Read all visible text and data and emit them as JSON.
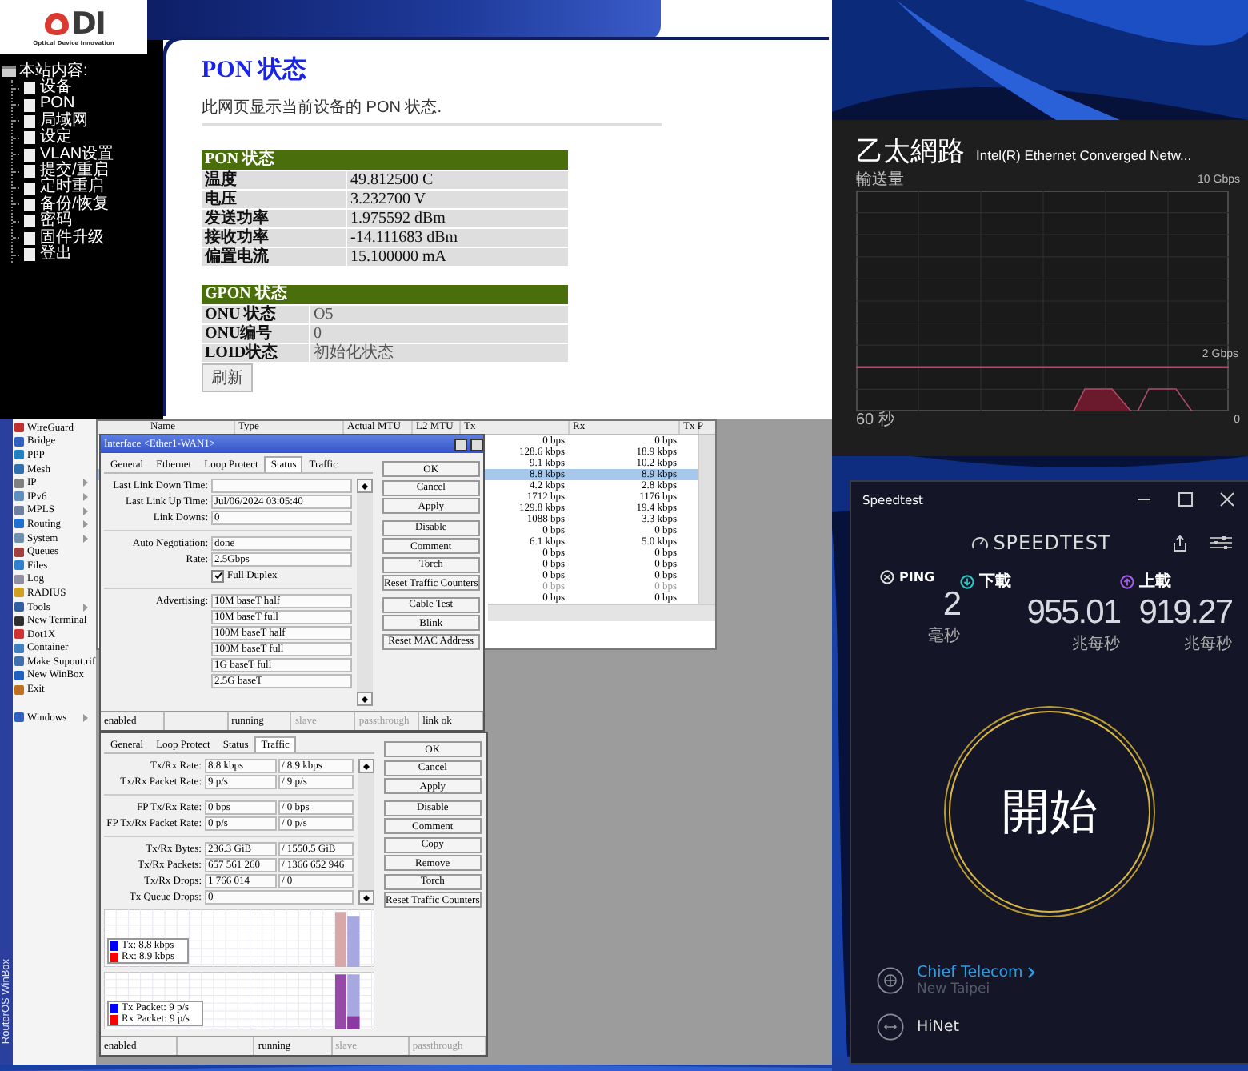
{
  "web_page": {
    "logo": {
      "text": "DI",
      "tagline": "Optical Device Innovation"
    },
    "sidebar": {
      "title": "本站内容:",
      "items": [
        "设备",
        "PON",
        "局域网",
        "设定",
        "VLAN设置",
        "提交/重启",
        "定时重启",
        "备份/恢复",
        "密码",
        "固件升级",
        "登出"
      ]
    },
    "title": "PON 状态",
    "description": "此网页显示当前设备的 PON 状态.",
    "tables": [
      {
        "heading": "PON 状态",
        "rows": [
          [
            "温度",
            "49.812500 C"
          ],
          [
            "电压",
            "3.232700 V"
          ],
          [
            "发送功率",
            "1.975592 dBm"
          ],
          [
            "接收功率",
            "-14.111683 dBm"
          ],
          [
            "偏置电流",
            "15.100000 mA"
          ]
        ]
      },
      {
        "heading": "GPON 状态",
        "rows": [
          [
            "ONU 状态",
            "O5"
          ],
          [
            "ONU编号",
            "0"
          ],
          [
            "LOID状态",
            "初始化状态"
          ]
        ]
      }
    ],
    "refresh_button": "刷新"
  },
  "task_manager": {
    "title": "乙太網路",
    "adapter": "Intel(R) Ethernet Converged Netw...",
    "chart_label": "輸送量",
    "max_label": "10 Gbps",
    "scale_label": "2 Gbps",
    "time_label": "60 秒",
    "zero_label": "0"
  },
  "speedtest": {
    "window_title": "Speedtest",
    "brand": "SPEEDTEST",
    "metrics": [
      {
        "kind": "ping",
        "label": "PING",
        "value": "2",
        "unit": "毫秒"
      },
      {
        "kind": "download",
        "label": "下載",
        "value": "955.01",
        "unit": "兆每秒"
      },
      {
        "kind": "upload",
        "label": "上載",
        "value": "919.27",
        "unit": "兆每秒"
      }
    ],
    "start_button": "開始",
    "server": {
      "name": "Chief Telecom",
      "location": "New Taipei"
    },
    "provider": "HiNet"
  },
  "winbox": {
    "vertical_label": "RouterOS WinBox",
    "menu": [
      {
        "label": "WireGuard",
        "submenu": false
      },
      {
        "label": "Bridge",
        "submenu": false
      },
      {
        "label": "PPP",
        "submenu": false
      },
      {
        "label": "Mesh",
        "submenu": false
      },
      {
        "label": "IP",
        "submenu": true
      },
      {
        "label": "IPv6",
        "submenu": true
      },
      {
        "label": "MPLS",
        "submenu": true
      },
      {
        "label": "Routing",
        "submenu": true
      },
      {
        "label": "System",
        "submenu": true
      },
      {
        "label": "Queues",
        "submenu": false
      },
      {
        "label": "Files",
        "submenu": false
      },
      {
        "label": "Log",
        "submenu": false
      },
      {
        "label": "RADIUS",
        "submenu": false
      },
      {
        "label": "Tools",
        "submenu": true
      },
      {
        "label": "New Terminal",
        "submenu": false
      },
      {
        "label": "Dot1X",
        "submenu": false
      },
      {
        "label": "Container",
        "submenu": false
      },
      {
        "label": "Make Supout.rif",
        "submenu": false
      },
      {
        "label": "New WinBox",
        "submenu": false
      },
      {
        "label": "Exit",
        "submenu": false
      }
    ],
    "windows_item": {
      "label": "Windows",
      "submenu": true
    },
    "interface_list": {
      "columns": [
        "Name",
        "Type",
        "Actual MTU",
        "L2 MTU",
        "Tx",
        "Rx",
        "Tx P"
      ],
      "rows": [
        {
          "tx": "0 bps",
          "rx": "0 bps",
          "selected": false,
          "disabled": false
        },
        {
          "tx": "128.6 kbps",
          "rx": "18.9 kbps",
          "selected": false,
          "disabled": false
        },
        {
          "tx": "9.1 kbps",
          "rx": "10.2 kbps",
          "selected": false,
          "disabled": false
        },
        {
          "tx": "8.8 kbps",
          "rx": "8.9 kbps",
          "selected": true,
          "disabled": false
        },
        {
          "tx": "4.2 kbps",
          "rx": "2.8 kbps",
          "selected": false,
          "disabled": false
        },
        {
          "tx": "1712 bps",
          "rx": "1176 bps",
          "selected": false,
          "disabled": false
        },
        {
          "tx": "129.8 kbps",
          "rx": "19.4 kbps",
          "selected": false,
          "disabled": false
        },
        {
          "tx": "1088 bps",
          "rx": "3.3 kbps",
          "selected": false,
          "disabled": false
        },
        {
          "tx": "0 bps",
          "rx": "0 bps",
          "selected": false,
          "disabled": false
        },
        {
          "tx": "6.1 kbps",
          "rx": "5.0 kbps",
          "selected": false,
          "disabled": false
        },
        {
          "tx": "0 bps",
          "rx": "0 bps",
          "selected": false,
          "disabled": false
        },
        {
          "tx": "0 bps",
          "rx": "0 bps",
          "selected": false,
          "disabled": false
        },
        {
          "tx": "0 bps",
          "rx": "0 bps",
          "selected": false,
          "disabled": false
        },
        {
          "tx": "0 bps",
          "rx": "0 bps",
          "selected": false,
          "disabled": true
        },
        {
          "tx": "0 bps",
          "rx": "0 bps",
          "selected": false,
          "disabled": false
        }
      ]
    },
    "interface_window": {
      "title": "Interface <Ether1-WAN1>",
      "tabs": [
        {
          "label": "General",
          "selected": false
        },
        {
          "label": "Ethernet",
          "selected": false
        },
        {
          "label": "Loop Protect",
          "selected": false
        },
        {
          "label": "Status",
          "selected": true
        },
        {
          "label": "Traffic",
          "selected": false
        }
      ],
      "fields": [
        {
          "kind": "field",
          "label": "Last Link Down Time:"
        },
        {
          "kind": "field",
          "label": "Last Link Up Time:",
          "value": "Jul/06/2024 03:05:40"
        },
        {
          "kind": "field",
          "label": "Link Downs:",
          "value": "0"
        },
        {
          "kind": "separator"
        },
        {
          "kind": "field",
          "label": "Auto Negotiation:",
          "value": "done"
        },
        {
          "kind": "field",
          "label": "Rate:",
          "value": "2.5Gbps"
        },
        {
          "kind": "checkbox",
          "label": "Full Duplex",
          "checked": true
        },
        {
          "kind": "separator"
        },
        {
          "kind": "list",
          "label": "Advertising:",
          "values": [
            "10M baseT half",
            "10M baseT full",
            "100M baseT half",
            "100M baseT full",
            "1G baseT full",
            "2.5G baseT"
          ]
        }
      ],
      "buttons": [
        "OK",
        "Cancel",
        "Apply",
        "Disable",
        "Comment",
        "Torch",
        "Reset Traffic Counters",
        "Cable Test",
        "Blink",
        "Reset MAC Address"
      ],
      "status": [
        {
          "text": "enabled",
          "disabled": false
        },
        {
          "text": "running",
          "disabled": false
        },
        {
          "text": "slave",
          "disabled": true
        },
        {
          "text": "passthrough",
          "disabled": true
        },
        {
          "text": "link ok",
          "disabled": false
        }
      ]
    },
    "traffic_window": {
      "tabs": [
        {
          "label": "General",
          "selected": false
        },
        {
          "label": "Loop Protect",
          "selected": false
        },
        {
          "label": "Status",
          "selected": false
        },
        {
          "label": "Traffic",
          "selected": true
        }
      ],
      "fields": [
        {
          "kind": "pair",
          "label": "Tx/Rx Rate:",
          "value": "8.8 kbps",
          "value2": "/ 8.9 kbps"
        },
        {
          "kind": "pair",
          "label": "Tx/Rx Packet Rate:",
          "value": "9 p/s",
          "value2": "/ 9 p/s"
        },
        {
          "kind": "separator"
        },
        {
          "kind": "pair",
          "label": "FP Tx/Rx Rate:",
          "value": "0 bps",
          "value2": "/ 0 bps"
        },
        {
          "kind": "pair",
          "label": "FP Tx/Rx Packet Rate:",
          "value": "0 p/s",
          "value2": "/ 0 p/s"
        },
        {
          "kind": "separator"
        },
        {
          "kind": "pair",
          "label": "Tx/Rx Bytes:",
          "value": "236.3 GiB",
          "value2": "/ 1550.5 GiB"
        },
        {
          "kind": "pair",
          "label": "Tx/Rx Packets:",
          "value": "657 561 260",
          "value2": "/ 1366 652 946"
        },
        {
          "kind": "pair",
          "label": "Tx/Rx Drops:",
          "value": "1 766 014",
          "value2": "/ 0"
        },
        {
          "kind": "field",
          "label": "Tx Queue Drops:",
          "value": "0"
        }
      ],
      "graphs": [
        {
          "legend": [
            {
              "text": "Tx: 8.8 kbps",
              "color": "#0000ff"
            },
            {
              "text": "Rx: 8.9 kbps",
              "color": "#ff0000"
            }
          ]
        },
        {
          "legend": [
            {
              "text": "Tx Packet: 9 p/s",
              "color": "#0000ff"
            },
            {
              "text": "Rx Packet: 9 p/s",
              "color": "#ff0000"
            }
          ]
        }
      ],
      "buttons": [
        "OK",
        "Cancel",
        "Apply",
        "Disable",
        "Comment",
        "Copy",
        "Remove",
        "Torch",
        "Reset Traffic Counters"
      ],
      "status": [
        {
          "text": "enabled",
          "disabled": false
        },
        {
          "text": "running",
          "disabled": false
        },
        {
          "text": "slave",
          "disabled": true
        },
        {
          "text": "passthrough",
          "disabled": true
        }
      ]
    }
  }
}
